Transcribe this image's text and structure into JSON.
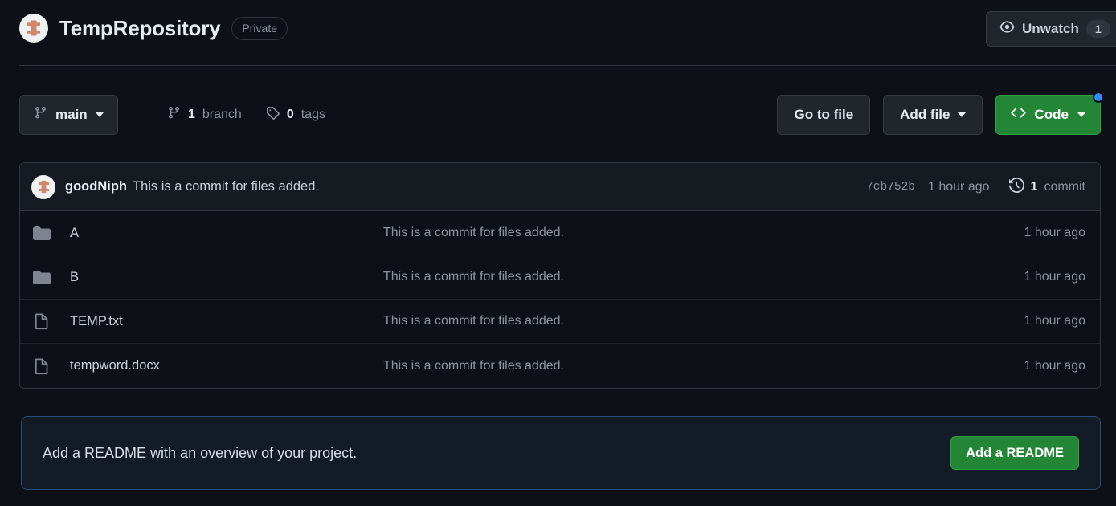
{
  "header": {
    "repo_name": "TempRepository",
    "visibility": "Private",
    "repo_icon": "repo-icon",
    "watch": {
      "label": "Unwatch",
      "icon": "eye-icon",
      "count": "1"
    }
  },
  "toolbar": {
    "branch": {
      "icon": "git-branch-icon",
      "label": "main"
    },
    "branch_count": {
      "icon": "git-branch-icon",
      "value": "1",
      "label": "branch"
    },
    "tag_count": {
      "icon": "tag-icon",
      "value": "0",
      "label": "tags"
    },
    "go_to_file_label": "Go to file",
    "add_file_label": "Add file",
    "code_label": "Code",
    "code_icon": "code-brackets-icon"
  },
  "commit_bar": {
    "avatar_icon": "repo-icon",
    "author": "goodNiph",
    "message": "This is a commit for files added.",
    "sha": "7cb752b",
    "time": "1 hour ago",
    "history_icon": "history-icon",
    "commit_count_value": "1",
    "commit_count_label": "commit"
  },
  "files": [
    {
      "icon": "folder-icon",
      "type": "folder",
      "name": "A",
      "message": "This is a commit for files added.",
      "time": "1 hour ago"
    },
    {
      "icon": "folder-icon",
      "type": "folder",
      "name": "B",
      "message": "This is a commit for files added.",
      "time": "1 hour ago"
    },
    {
      "icon": "file-icon",
      "type": "file",
      "name": "TEMP.txt",
      "message": "This is a commit for files added.",
      "time": "1 hour ago"
    },
    {
      "icon": "file-icon",
      "type": "file",
      "name": "tempword.docx",
      "message": "This is a commit for files added.",
      "time": "1 hour ago"
    }
  ],
  "readme_banner": {
    "text": "Add a README with an overview of your project.",
    "button_label": "Add a README"
  },
  "colors": {
    "page_background": "#0d1117",
    "surface": "#161b22",
    "border": "#30363d",
    "text_primary": "#e6edf3",
    "text_muted": "#8b949e",
    "green_button": "#238636",
    "blue_dot": "#388bfd",
    "banner_border": "#2a4d77",
    "repo_glyph": "#d08770"
  }
}
